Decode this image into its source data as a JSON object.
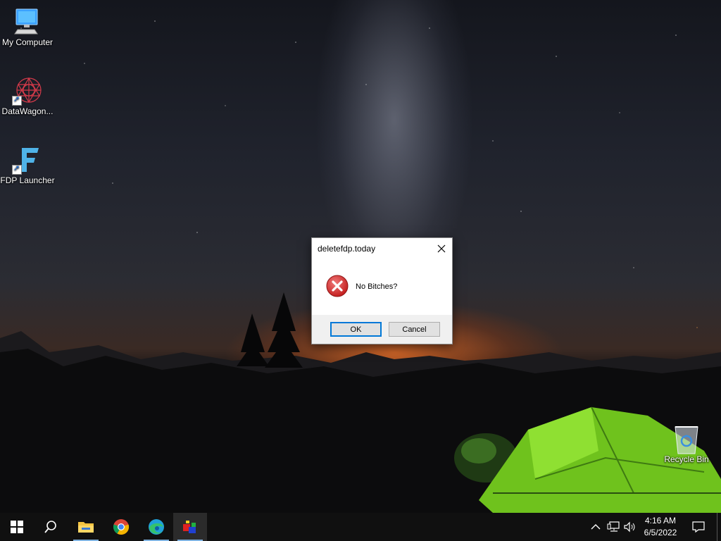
{
  "desktop": {
    "icons": [
      {
        "label": "My Computer",
        "icon": "computer-icon"
      },
      {
        "label": "DataWagon...",
        "icon": "datawagon-icon"
      },
      {
        "label": "FDP Launcher",
        "icon": "fdp-launcher-icon"
      },
      {
        "label": "Recycle Bin",
        "icon": "recycle-bin-icon"
      }
    ]
  },
  "dialog": {
    "title": "deletefdp.today",
    "message": "No Bitches?",
    "icon": "error-icon",
    "ok_label": "OK",
    "cancel_label": "Cancel"
  },
  "taskbar": {
    "pinned": [
      "start-icon",
      "search-icon",
      "file-explorer-icon",
      "chrome-icon",
      "edge-icon",
      "app-icon"
    ],
    "tray_icons": [
      "chevron-up-icon",
      "network-icon",
      "volume-icon"
    ],
    "clock": {
      "time": "4:16 AM",
      "date": "6/5/2022"
    },
    "notification_icon": "action-center-icon"
  },
  "colors": {
    "accent": "#0078d7",
    "taskbar": "#101010",
    "error_red": "#d32f2f",
    "tent_green": "#7ed321"
  }
}
